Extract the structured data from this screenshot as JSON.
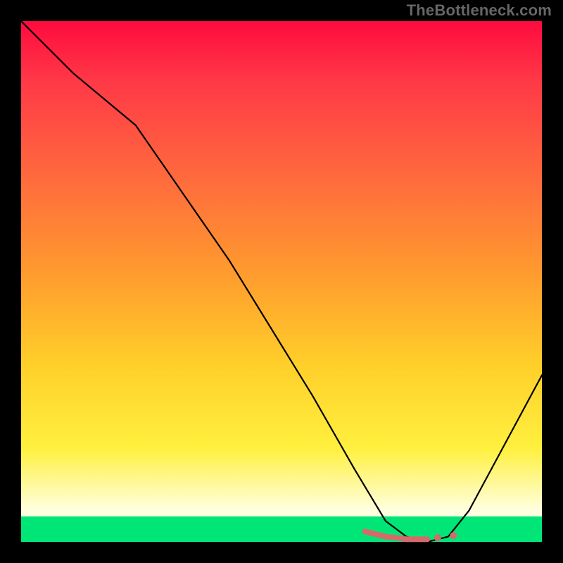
{
  "watermark": "TheBottleneck.com",
  "chart_data": {
    "type": "line",
    "title": "",
    "xlabel": "",
    "ylabel": "",
    "xlim": [
      0,
      100
    ],
    "ylim": [
      0,
      100
    ],
    "grid": false,
    "series": [
      {
        "name": "bottleneck-curve",
        "x": [
          0,
          10,
          22,
          40,
          56,
          64,
          70,
          74,
          78,
          82,
          86,
          100
        ],
        "values": [
          100,
          90,
          80,
          54,
          28,
          14,
          4,
          1,
          0,
          1,
          6,
          32
        ]
      }
    ],
    "highlight_cluster": {
      "name": "optimal-points",
      "x": [
        66,
        68,
        70,
        72,
        74,
        76,
        78,
        80,
        83
      ],
      "values": [
        2,
        1.5,
        1,
        0.8,
        0.5,
        0.5,
        0.5,
        0.8,
        1.2
      ]
    },
    "background_gradient": {
      "stops": [
        {
          "pos": 0.0,
          "color": "#ff0b3e"
        },
        {
          "pos": 0.3,
          "color": "#ff6a3d"
        },
        {
          "pos": 0.66,
          "color": "#ffcf2a"
        },
        {
          "pos": 0.94,
          "color": "#ffffe0"
        },
        {
          "pos": 0.952,
          "color": "#00e676"
        },
        {
          "pos": 1.0,
          "color": "#00e676"
        }
      ]
    }
  }
}
